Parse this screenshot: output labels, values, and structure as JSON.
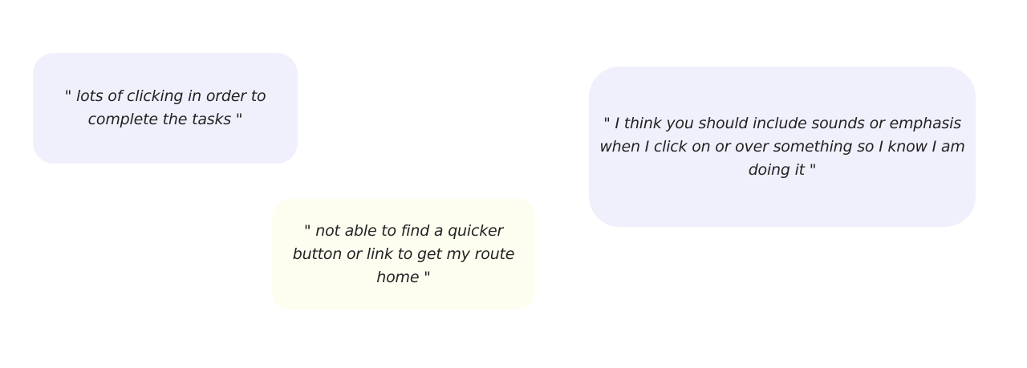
{
  "colors": {
    "background": "#ffffff",
    "lavender_card": "#f0f0fd",
    "cream_card": "#fefef0",
    "text": "#222222"
  },
  "notes": [
    {
      "text": "\" lots of clicking in order to complete the tasks \""
    },
    {
      "text": "\" not able to find a quicker button or link to get my route home \""
    },
    {
      "text": "\" I think you should include sounds or emphasis when I click on or over something so I know I am doing it \""
    }
  ]
}
